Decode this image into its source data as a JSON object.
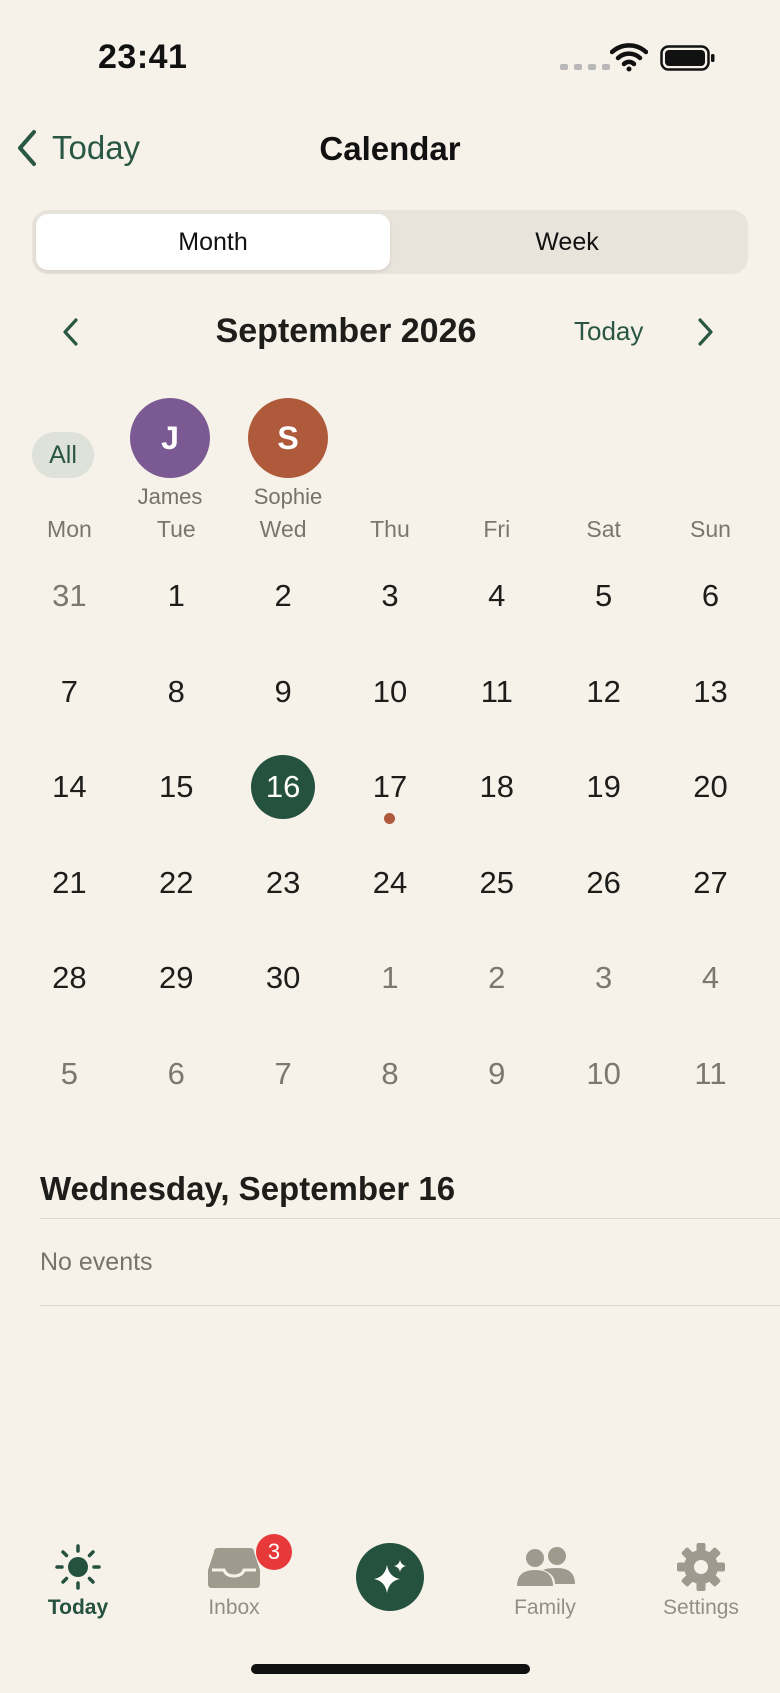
{
  "status": {
    "time": "23:41"
  },
  "nav": {
    "back_label": "Today",
    "title": "Calendar"
  },
  "view_toggle": {
    "month": "Month",
    "week": "Week",
    "selected": "Month"
  },
  "month_header": {
    "title": "September 2026",
    "today_label": "Today"
  },
  "members": {
    "all_label": "All",
    "people": [
      {
        "initial": "J",
        "name": "James",
        "color": "#7b5a93"
      },
      {
        "initial": "S",
        "name": "Sophie",
        "color": "#b05a3c"
      }
    ]
  },
  "weekdays": [
    "Mon",
    "Tue",
    "Wed",
    "Thu",
    "Fri",
    "Sat",
    "Sun"
  ],
  "calendar": {
    "selected_day": "16",
    "event_dot_color": "#b0583e",
    "weeks": [
      [
        "31",
        "1",
        "2",
        "3",
        "4",
        "5",
        "6"
      ],
      [
        "7",
        "8",
        "9",
        "10",
        "11",
        "12",
        "13"
      ],
      [
        "14",
        "15",
        "16",
        "17",
        "18",
        "19",
        "20"
      ],
      [
        "21",
        "22",
        "23",
        "24",
        "25",
        "26",
        "27"
      ],
      [
        "28",
        "29",
        "30",
        "1",
        "2",
        "3",
        "4"
      ],
      [
        "5",
        "6",
        "7",
        "8",
        "9",
        "10",
        "11"
      ]
    ]
  },
  "day_detail": {
    "heading": "Wednesday, September 16",
    "empty_text": "No events"
  },
  "tabs": {
    "today": "Today",
    "inbox": "Inbox",
    "inbox_badge": "3",
    "family": "Family",
    "settings": "Settings"
  },
  "colors": {
    "accent": "#25523f",
    "background": "#f6f2ea",
    "badge": "#e8393a"
  }
}
